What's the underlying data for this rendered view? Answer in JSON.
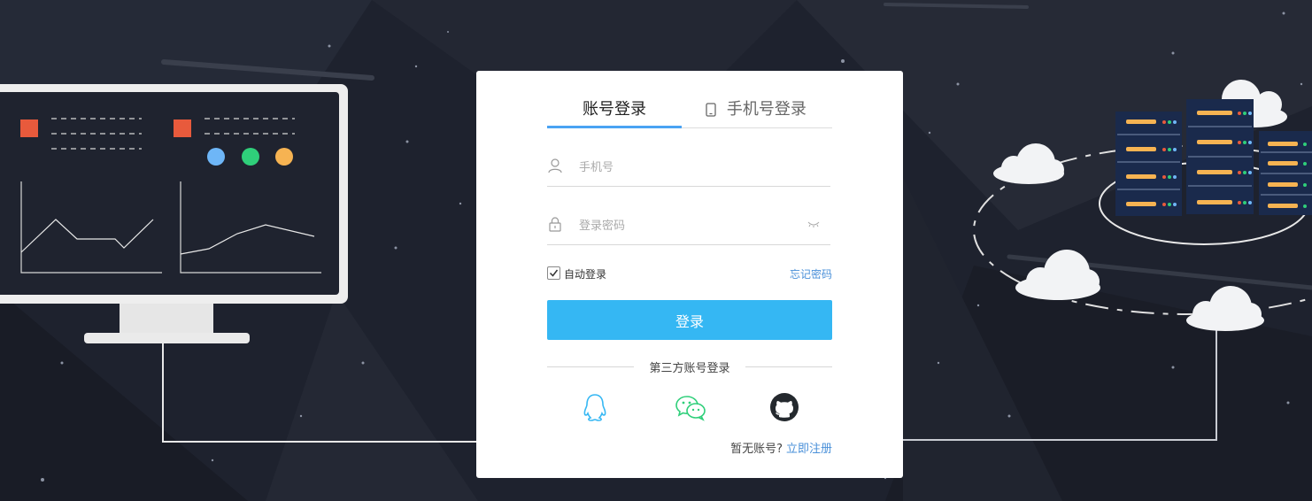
{
  "tabs": [
    {
      "label": "账号登录",
      "active": true
    },
    {
      "label": "手机号登录",
      "active": false,
      "icon": "mobile-phone-icon"
    }
  ],
  "fields": {
    "phone": {
      "placeholder": "手机号",
      "icon": "user-icon"
    },
    "password": {
      "placeholder": "登录密码",
      "icon": "lock-icon"
    }
  },
  "options": {
    "auto_login_label": "自动登录",
    "auto_login_checked": true,
    "forgot_password": "忘记密码"
  },
  "login_button": "登录",
  "third_party": {
    "title": "第三方账号登录",
    "providers": [
      "qq-icon",
      "wechat-icon",
      "github-icon"
    ]
  },
  "footer": {
    "no_account": "暂无账号?",
    "register": "立即注册"
  },
  "colors": {
    "background": "#1e222e",
    "accent": "#35b7f3",
    "link": "#4a90d9",
    "tab_underline": "#4aa3f3"
  }
}
